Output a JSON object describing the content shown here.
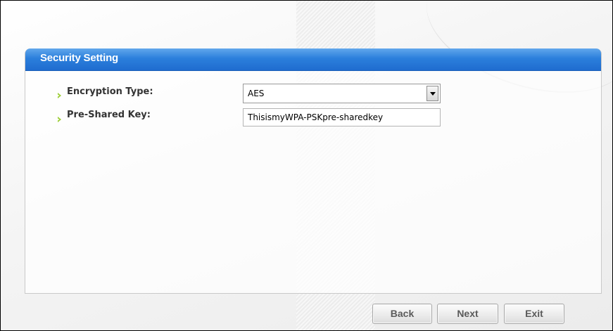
{
  "panel": {
    "title": "Security Setting"
  },
  "form": {
    "encryption_type": {
      "label": "Encryption Type:",
      "value": "AES"
    },
    "pre_shared_key": {
      "label": "Pre-Shared Key:",
      "value": "ThisismyWPA-PSKpre-sharedkey"
    }
  },
  "buttons": {
    "back": "Back",
    "next": "Next",
    "exit": "Exit"
  },
  "colors": {
    "header_blue": "#2b7fdc",
    "bullet_green": "#9acd32"
  },
  "icons": {
    "bullet": "chevron-right-icon",
    "dropdown": "triangle-down-icon"
  }
}
